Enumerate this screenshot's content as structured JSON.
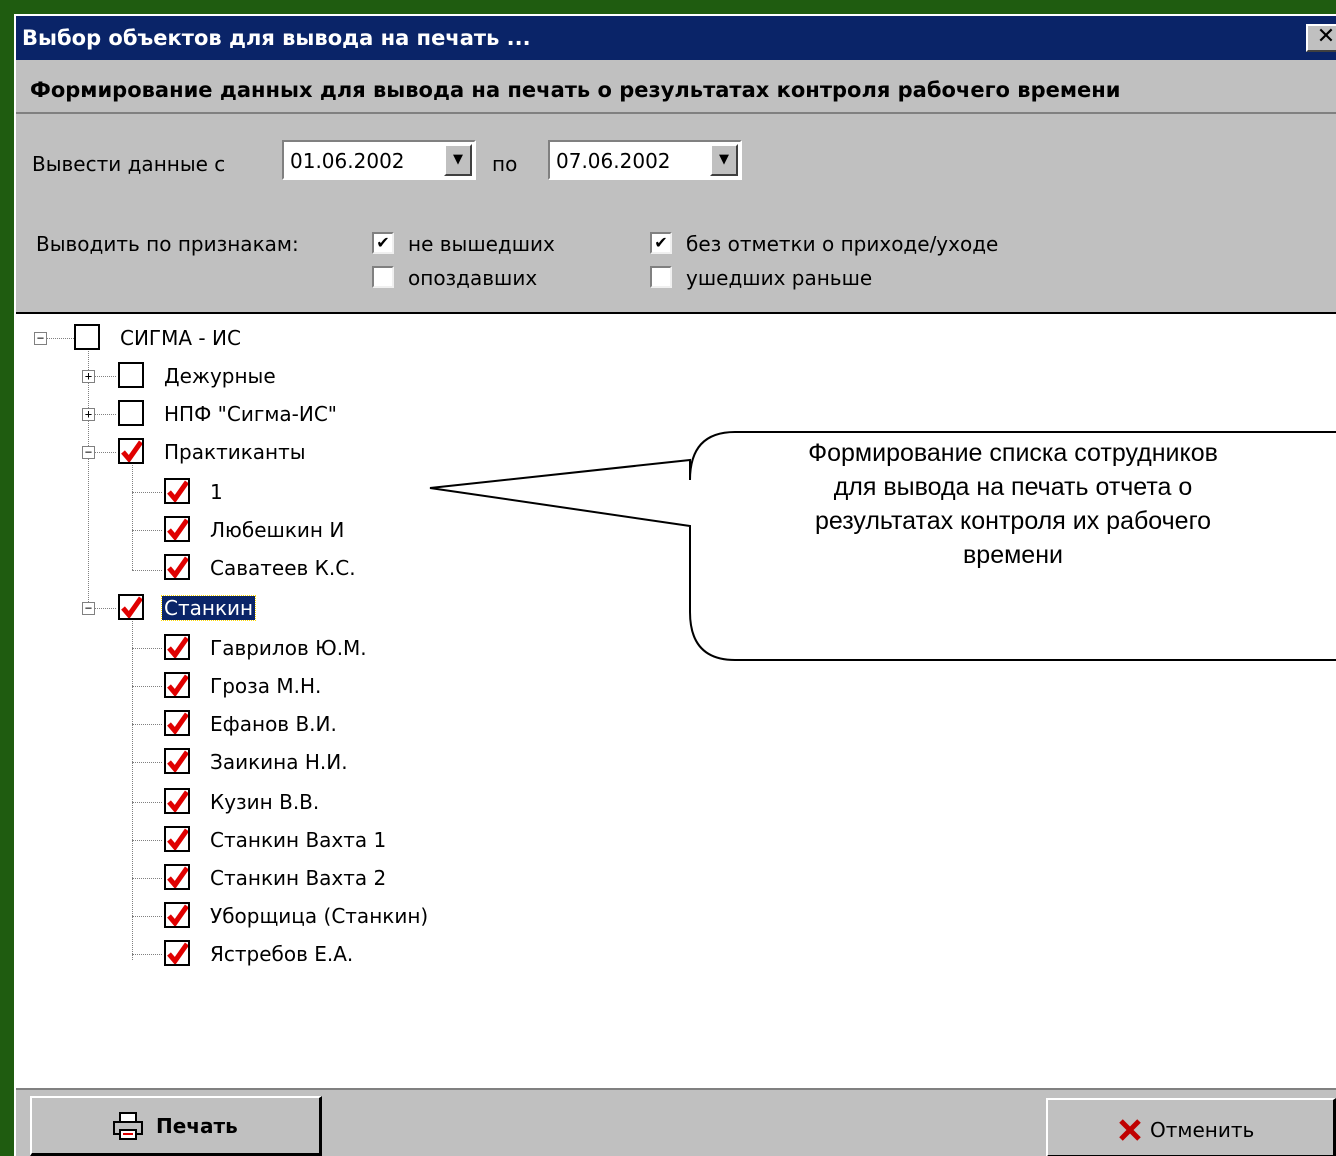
{
  "window": {
    "title": "Выбор объектов для вывода на печать ...",
    "close_glyph": "✕"
  },
  "heading": "Формирование данных для вывода на печать о результатах контроля рабочего времени",
  "date_range": {
    "from_label": "Вывести данные с",
    "from_value": "01.06.2002",
    "to_label": "по",
    "to_value": "07.06.2002"
  },
  "filters": {
    "label": "Выводить по признакам:",
    "options": [
      {
        "label": "не вышедших",
        "checked": true
      },
      {
        "label": "опоздавших",
        "checked": false
      },
      {
        "label": "без отметки о приходе/уходе",
        "checked": true
      },
      {
        "label": "ушедших раньше",
        "checked": false
      }
    ]
  },
  "tree": {
    "root": "СИГМА - ИС",
    "nodes": [
      {
        "label": "Дежурные",
        "checked": false
      },
      {
        "label": "НПФ \"Сигма-ИС\"",
        "checked": false
      },
      {
        "label": "Практиканты",
        "checked": true
      },
      {
        "label": "1",
        "checked": true
      },
      {
        "label": "Любешкин И",
        "checked": true
      },
      {
        "label": "Саватеев К.С.",
        "checked": true
      },
      {
        "label": "Станкин",
        "checked": true
      },
      {
        "label": "Гаврилов Ю.М.",
        "checked": true
      },
      {
        "label": "Гроза М.Н.",
        "checked": true
      },
      {
        "label": "Ефанов В.И.",
        "checked": true
      },
      {
        "label": "Заикина Н.И.",
        "checked": true
      },
      {
        "label": "Кузин В.В.",
        "checked": true
      },
      {
        "label": "Станкин Вахта 1",
        "checked": true
      },
      {
        "label": "Станкин Вахта 2",
        "checked": true
      },
      {
        "label": "Уборщица (Станкин)",
        "checked": true
      },
      {
        "label": "Ястребов Е.А.",
        "checked": true
      }
    ]
  },
  "callout": {
    "lines": [
      "Формирование списка сотрудников",
      "для вывода на печать отчета о",
      "результатах контроля их рабочего",
      "времени"
    ]
  },
  "buttons": {
    "print": "Печать",
    "cancel": "Отменить"
  },
  "colors": {
    "desktop": "#1f5c10",
    "titlebar": "#0a2468",
    "face": "#c0c0c0",
    "check_red": "#e00000"
  }
}
